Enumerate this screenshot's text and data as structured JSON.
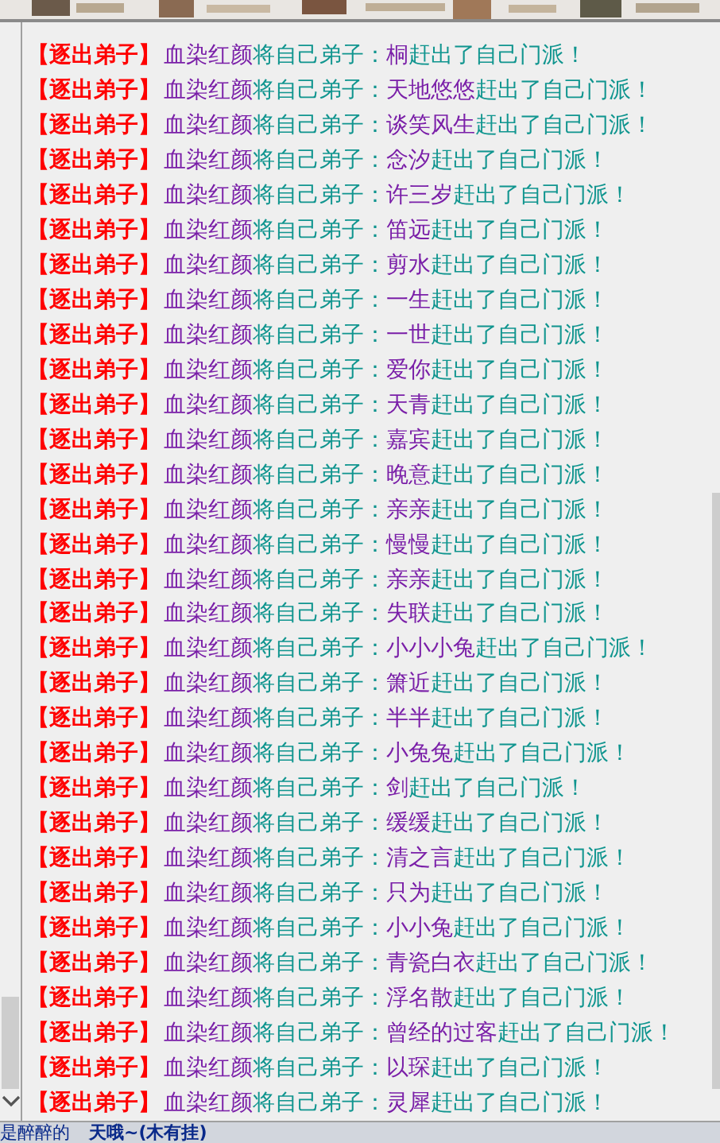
{
  "log": [
    {
      "tag": "【逐出弟子】",
      "actor": "血染红颜",
      "verb": "将自己弟子：",
      "target": "桐",
      "result": "赶出了自己门派！"
    },
    {
      "tag": "【逐出弟子】",
      "actor": "血染红颜",
      "verb": "将自己弟子：",
      "target": "天地悠悠",
      "result": "赶出了自己门派！"
    },
    {
      "tag": "【逐出弟子】",
      "actor": "血染红颜",
      "verb": "将自己弟子：",
      "target": "谈笑风生",
      "result": "赶出了自己门派！"
    },
    {
      "tag": "【逐出弟子】",
      "actor": "血染红颜",
      "verb": "将自己弟子：",
      "target": "念汐",
      "result": "赶出了自己门派！"
    },
    {
      "tag": "【逐出弟子】",
      "actor": "血染红颜",
      "verb": "将自己弟子：",
      "target": "许三岁",
      "result": "赶出了自己门派！"
    },
    {
      "tag": "【逐出弟子】",
      "actor": "血染红颜",
      "verb": "将自己弟子：",
      "target": "笛远",
      "result": "赶出了自己门派！"
    },
    {
      "tag": "【逐出弟子】",
      "actor": "血染红颜",
      "verb": "将自己弟子：",
      "target": "剪水",
      "result": "赶出了自己门派！"
    },
    {
      "tag": "【逐出弟子】",
      "actor": "血染红颜",
      "verb": "将自己弟子：",
      "target": "一生",
      "result": "赶出了自己门派！"
    },
    {
      "tag": "【逐出弟子】",
      "actor": "血染红颜",
      "verb": "将自己弟子：",
      "target": "一世",
      "result": "赶出了自己门派！"
    },
    {
      "tag": "【逐出弟子】",
      "actor": "血染红颜",
      "verb": "将自己弟子：",
      "target": "爱你",
      "result": "赶出了自己门派！"
    },
    {
      "tag": "【逐出弟子】",
      "actor": "血染红颜",
      "verb": "将自己弟子：",
      "target": "天青",
      "result": "赶出了自己门派！"
    },
    {
      "tag": "【逐出弟子】",
      "actor": "血染红颜",
      "verb": "将自己弟子：",
      "target": "嘉宾",
      "result": "赶出了自己门派！"
    },
    {
      "tag": "【逐出弟子】",
      "actor": "血染红颜",
      "verb": "将自己弟子：",
      "target": "晚意",
      "result": "赶出了自己门派！"
    },
    {
      "tag": "【逐出弟子】",
      "actor": "血染红颜",
      "verb": "将自己弟子：",
      "target": "亲亲",
      "result": "赶出了自己门派！"
    },
    {
      "tag": "【逐出弟子】",
      "actor": "血染红颜",
      "verb": "将自己弟子：",
      "target": "慢慢",
      "result": "赶出了自己门派！"
    },
    {
      "tag": "【逐出弟子】",
      "actor": "血染红颜",
      "verb": "将自己弟子：",
      "target": "亲亲",
      "result": "赶出了自己门派！"
    },
    {
      "tag": "【逐出弟子】",
      "actor": "血染红颜",
      "verb": "将自己弟子：",
      "target": "失联",
      "result": "赶出了自己门派！"
    },
    {
      "tag": "【逐出弟子】",
      "actor": "血染红颜",
      "verb": "将自己弟子：",
      "target": "小小小兔",
      "result": "赶出了自己门派！"
    },
    {
      "tag": "【逐出弟子】",
      "actor": "血染红颜",
      "verb": "将自己弟子：",
      "target": "箫近",
      "result": "赶出了自己门派！"
    },
    {
      "tag": "【逐出弟子】",
      "actor": "血染红颜",
      "verb": "将自己弟子：",
      "target": "半半",
      "result": "赶出了自己门派！"
    },
    {
      "tag": "【逐出弟子】",
      "actor": "血染红颜",
      "verb": "将自己弟子：",
      "target": "小兔兔",
      "result": "赶出了自己门派！"
    },
    {
      "tag": "【逐出弟子】",
      "actor": "血染红颜",
      "verb": "将自己弟子：",
      "target": "剑",
      "result": "赶出了自己门派！"
    },
    {
      "tag": "【逐出弟子】",
      "actor": "血染红颜",
      "verb": "将自己弟子：",
      "target": "缓缓",
      "result": "赶出了自己门派！"
    },
    {
      "tag": "【逐出弟子】",
      "actor": "血染红颜",
      "verb": "将自己弟子：",
      "target": "清之言",
      "result": "赶出了自己门派！"
    },
    {
      "tag": "【逐出弟子】",
      "actor": "血染红颜",
      "verb": "将自己弟子：",
      "target": "只为",
      "result": "赶出了自己门派！"
    },
    {
      "tag": "【逐出弟子】",
      "actor": "血染红颜",
      "verb": "将自己弟子：",
      "target": "小小兔",
      "result": "赶出了自己门派！"
    },
    {
      "tag": "【逐出弟子】",
      "actor": "血染红颜",
      "verb": "将自己弟子：",
      "target": "青瓷白衣",
      "result": "赶出了自己门派！"
    },
    {
      "tag": "【逐出弟子】",
      "actor": "血染红颜",
      "verb": "将自己弟子：",
      "target": "浮名散",
      "result": "赶出了自己门派！"
    },
    {
      "tag": "【逐出弟子】",
      "actor": "血染红颜",
      "verb": "将自己弟子：",
      "target": "曾经的过客",
      "result": "赶出了自己门派！"
    },
    {
      "tag": "【逐出弟子】",
      "actor": "血染红颜",
      "verb": "将自己弟子：",
      "target": "以琛",
      "result": "赶出了自己门派！"
    },
    {
      "tag": "【逐出弟子】",
      "actor": "血染红颜",
      "verb": "将自己弟子：",
      "target": "灵犀",
      "result": "赶出了自己门派！"
    }
  ],
  "bottom_bar": {
    "texts": [
      "是醉醉的",
      "天哦~(木有挂)"
    ]
  }
}
